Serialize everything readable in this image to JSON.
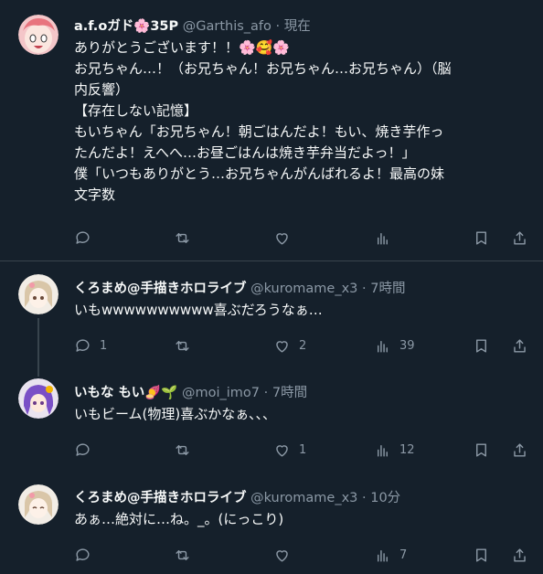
{
  "posts": [
    {
      "name": "a.f.oガド🌸35P",
      "handle": "@Garthis_afo",
      "sep": "·",
      "time": "現在",
      "lines": [
        "ありがとうございます！！🌸🥰🌸",
        "お兄ちゃん…！（お兄ちゃん！お兄ちゃん…お兄ちゃん）（脳",
        "内反響）",
        "【存在しない記憶】",
        "もいちゃん「お兄ちゃん！朝ごはんだよ！もい、焼き芋作っ",
        "たんだよ！えへへ…お昼ごはんは焼き芋弁当だよっ！」",
        "僕「いつもありがとう…お兄ちゃんがんばれるよ！最高の妹",
        "文字数"
      ],
      "counts": {
        "reply": "",
        "retweet": "",
        "like": "",
        "views": ""
      }
    },
    {
      "name": "くろまめ@手描きホロライブ",
      "handle": "@kuromame_x3",
      "sep": "·",
      "time": "7時間",
      "lines": [
        "いもwwwwwwwwww喜ぶだろうなぁ…"
      ],
      "counts": {
        "reply": "1",
        "retweet": "",
        "like": "2",
        "views": "39"
      }
    },
    {
      "name": "いもな もい🍠🌱",
      "handle": "@moi_imo7",
      "sep": "·",
      "time": "7時間",
      "lines": [
        "いもビーム(物理)喜ぶかなぁ、、、"
      ],
      "counts": {
        "reply": "",
        "retweet": "",
        "like": "1",
        "views": "12"
      }
    },
    {
      "name": "くろまめ@手描きホロライブ",
      "handle": "@kuromame_x3",
      "sep": "·",
      "time": "10分",
      "lines": [
        "あぁ…絶対に…ね。_。(にっこり)"
      ],
      "counts": {
        "reply": "",
        "retweet": "",
        "like": "",
        "views": "7"
      }
    }
  ],
  "colors": {
    "background": "#15202b",
    "text": "#f7f9f9",
    "muted": "#8b98a5",
    "divider": "#38444d"
  },
  "icons": [
    "reply-icon",
    "retweet-icon",
    "like-icon",
    "views-icon",
    "bookmark-icon",
    "share-icon"
  ]
}
